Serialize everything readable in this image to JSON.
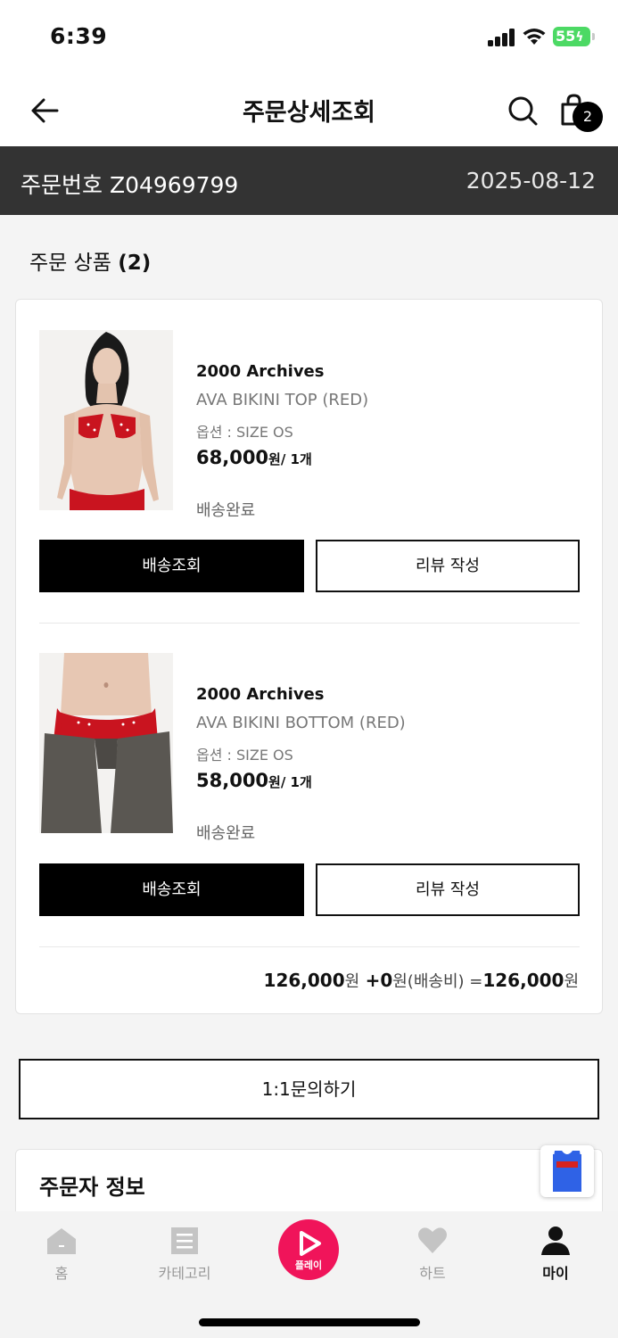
{
  "status_bar": {
    "time": "6:39",
    "battery": "55"
  },
  "header": {
    "title": "주문상세조회",
    "cart_count": "2"
  },
  "order": {
    "number_label": "주문번호 Z04969799",
    "date": "2025-08-12"
  },
  "section": {
    "title": "주문 상품",
    "count": "(2)"
  },
  "products": [
    {
      "brand": "2000 Archives",
      "name": "AVA BIKINI TOP (RED)",
      "option": "옵션 : SIZE OS",
      "price": "68,000",
      "price_unit": "원/ 1개",
      "status": "배송완료",
      "ship_button": "배송조회",
      "review_button": "리뷰 작성"
    },
    {
      "brand": "2000 Archives",
      "name": "AVA BIKINI BOTTOM (RED)",
      "option": "옵션 : SIZE OS",
      "price": "58,000",
      "price_unit": "원/ 1개",
      "status": "배송완료",
      "ship_button": "배송조회",
      "review_button": "리뷰 작성"
    }
  ],
  "total": {
    "subtotal": "126,000",
    "subtotal_unit": "원",
    "plus": "+0",
    "shipping_label": "원(배송비) =",
    "grand_total": "126,000",
    "grand_unit": "원"
  },
  "inquiry_button": "1:1문의하기",
  "orderer": {
    "title": "주문자 정보"
  },
  "bottom_nav": {
    "home": "홈",
    "category": "카테고리",
    "play": "플레이",
    "heart": "하트",
    "my": "마이"
  },
  "colors": {
    "accent": "#f0145a",
    "order_bar": "#333333",
    "battery": "#4cd964"
  },
  "icons": [
    "back-arrow-icon",
    "search-icon",
    "shopping-bag-icon",
    "home-icon",
    "category-icon",
    "play-icon",
    "heart-icon",
    "person-icon"
  ]
}
